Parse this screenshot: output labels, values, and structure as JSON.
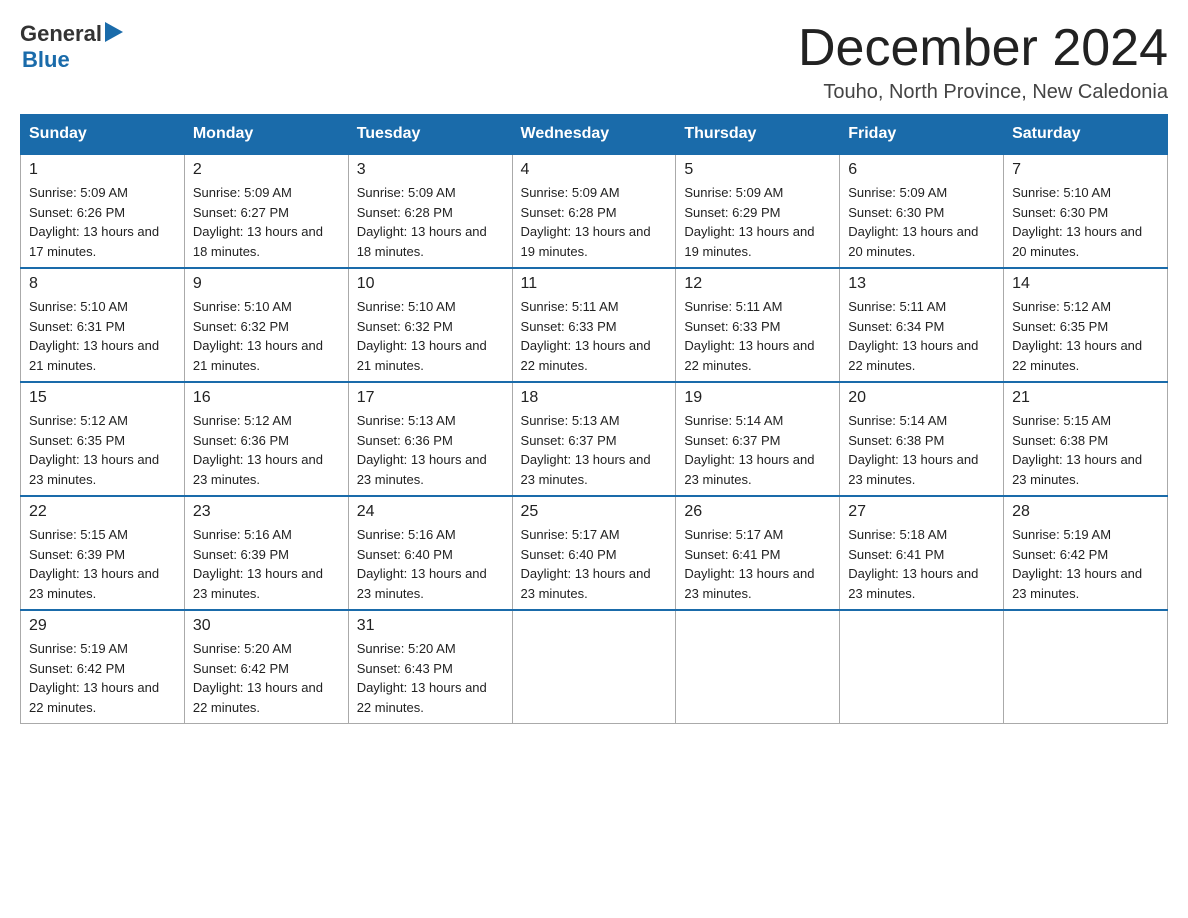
{
  "header": {
    "logo_general": "General",
    "logo_blue": "Blue",
    "month_title": "December 2024",
    "location": "Touho, North Province, New Caledonia"
  },
  "days_of_week": [
    "Sunday",
    "Monday",
    "Tuesday",
    "Wednesday",
    "Thursday",
    "Friday",
    "Saturday"
  ],
  "weeks": [
    [
      {
        "day": "1",
        "sunrise": "5:09 AM",
        "sunset": "6:26 PM",
        "daylight": "13 hours and 17 minutes."
      },
      {
        "day": "2",
        "sunrise": "5:09 AM",
        "sunset": "6:27 PM",
        "daylight": "13 hours and 18 minutes."
      },
      {
        "day": "3",
        "sunrise": "5:09 AM",
        "sunset": "6:28 PM",
        "daylight": "13 hours and 18 minutes."
      },
      {
        "day": "4",
        "sunrise": "5:09 AM",
        "sunset": "6:28 PM",
        "daylight": "13 hours and 19 minutes."
      },
      {
        "day": "5",
        "sunrise": "5:09 AM",
        "sunset": "6:29 PM",
        "daylight": "13 hours and 19 minutes."
      },
      {
        "day": "6",
        "sunrise": "5:09 AM",
        "sunset": "6:30 PM",
        "daylight": "13 hours and 20 minutes."
      },
      {
        "day": "7",
        "sunrise": "5:10 AM",
        "sunset": "6:30 PM",
        "daylight": "13 hours and 20 minutes."
      }
    ],
    [
      {
        "day": "8",
        "sunrise": "5:10 AM",
        "sunset": "6:31 PM",
        "daylight": "13 hours and 21 minutes."
      },
      {
        "day": "9",
        "sunrise": "5:10 AM",
        "sunset": "6:32 PM",
        "daylight": "13 hours and 21 minutes."
      },
      {
        "day": "10",
        "sunrise": "5:10 AM",
        "sunset": "6:32 PM",
        "daylight": "13 hours and 21 minutes."
      },
      {
        "day": "11",
        "sunrise": "5:11 AM",
        "sunset": "6:33 PM",
        "daylight": "13 hours and 22 minutes."
      },
      {
        "day": "12",
        "sunrise": "5:11 AM",
        "sunset": "6:33 PM",
        "daylight": "13 hours and 22 minutes."
      },
      {
        "day": "13",
        "sunrise": "5:11 AM",
        "sunset": "6:34 PM",
        "daylight": "13 hours and 22 minutes."
      },
      {
        "day": "14",
        "sunrise": "5:12 AM",
        "sunset": "6:35 PM",
        "daylight": "13 hours and 22 minutes."
      }
    ],
    [
      {
        "day": "15",
        "sunrise": "5:12 AM",
        "sunset": "6:35 PM",
        "daylight": "13 hours and 23 minutes."
      },
      {
        "day": "16",
        "sunrise": "5:12 AM",
        "sunset": "6:36 PM",
        "daylight": "13 hours and 23 minutes."
      },
      {
        "day": "17",
        "sunrise": "5:13 AM",
        "sunset": "6:36 PM",
        "daylight": "13 hours and 23 minutes."
      },
      {
        "day": "18",
        "sunrise": "5:13 AM",
        "sunset": "6:37 PM",
        "daylight": "13 hours and 23 minutes."
      },
      {
        "day": "19",
        "sunrise": "5:14 AM",
        "sunset": "6:37 PM",
        "daylight": "13 hours and 23 minutes."
      },
      {
        "day": "20",
        "sunrise": "5:14 AM",
        "sunset": "6:38 PM",
        "daylight": "13 hours and 23 minutes."
      },
      {
        "day": "21",
        "sunrise": "5:15 AM",
        "sunset": "6:38 PM",
        "daylight": "13 hours and 23 minutes."
      }
    ],
    [
      {
        "day": "22",
        "sunrise": "5:15 AM",
        "sunset": "6:39 PM",
        "daylight": "13 hours and 23 minutes."
      },
      {
        "day": "23",
        "sunrise": "5:16 AM",
        "sunset": "6:39 PM",
        "daylight": "13 hours and 23 minutes."
      },
      {
        "day": "24",
        "sunrise": "5:16 AM",
        "sunset": "6:40 PM",
        "daylight": "13 hours and 23 minutes."
      },
      {
        "day": "25",
        "sunrise": "5:17 AM",
        "sunset": "6:40 PM",
        "daylight": "13 hours and 23 minutes."
      },
      {
        "day": "26",
        "sunrise": "5:17 AM",
        "sunset": "6:41 PM",
        "daylight": "13 hours and 23 minutes."
      },
      {
        "day": "27",
        "sunrise": "5:18 AM",
        "sunset": "6:41 PM",
        "daylight": "13 hours and 23 minutes."
      },
      {
        "day": "28",
        "sunrise": "5:19 AM",
        "sunset": "6:42 PM",
        "daylight": "13 hours and 23 minutes."
      }
    ],
    [
      {
        "day": "29",
        "sunrise": "5:19 AM",
        "sunset": "6:42 PM",
        "daylight": "13 hours and 22 minutes."
      },
      {
        "day": "30",
        "sunrise": "5:20 AM",
        "sunset": "6:42 PM",
        "daylight": "13 hours and 22 minutes."
      },
      {
        "day": "31",
        "sunrise": "5:20 AM",
        "sunset": "6:43 PM",
        "daylight": "13 hours and 22 minutes."
      },
      null,
      null,
      null,
      null
    ]
  ]
}
